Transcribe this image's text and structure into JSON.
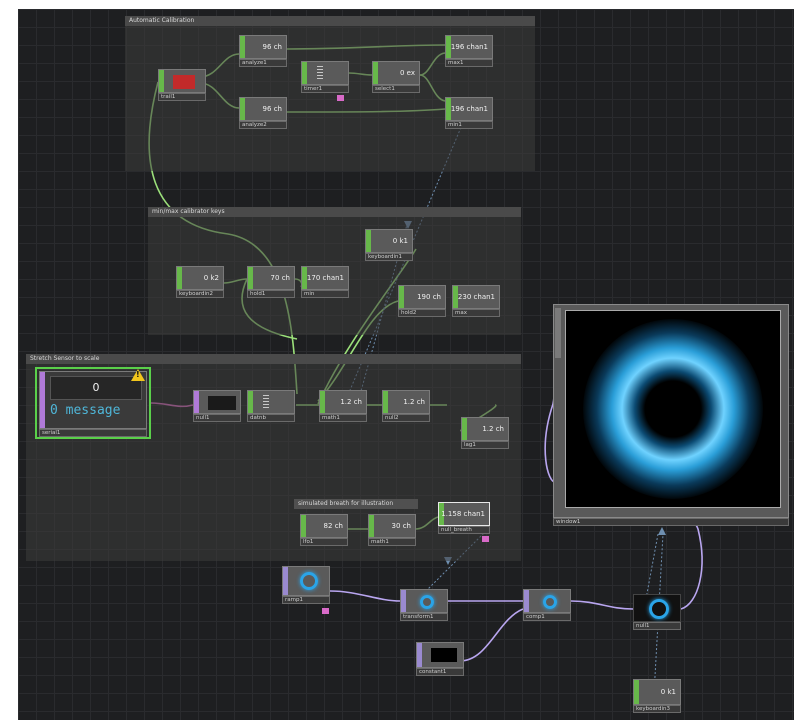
{
  "boxes": {
    "auto_calibration": "Automatic Calibration",
    "min_max_keys": "min/max calibrator keys",
    "stretch_sensor": "Stretch Sensor to scale",
    "simulated_breath": "simulated breath for illustration"
  },
  "nodes": {
    "serial1": {
      "label": "serial1",
      "value": "0",
      "message": "0 message",
      "warning": "!"
    },
    "analyze1": {
      "label": "analyze1",
      "value": "96",
      "unit": "ch"
    },
    "analyze2": {
      "label": "analyze2",
      "value": "96",
      "unit": "ch"
    },
    "timer1": {
      "label": "timer1"
    },
    "select1": {
      "label": "select1",
      "value": "0",
      "unit": "ex"
    },
    "max1": {
      "label": "max1",
      "value": "196",
      "unit": "chan1"
    },
    "min1": {
      "label": "min1",
      "value": "196",
      "unit": "chan1"
    },
    "trail1": {
      "label": "trail1"
    },
    "keyboardin1": {
      "label": "keyboardin1",
      "value": "0",
      "unit": "k1"
    },
    "keyboardin2": {
      "label": "keyboardin2",
      "value": "0",
      "unit": "k2"
    },
    "hold1": {
      "label": "hold1",
      "value": "70",
      "unit": "ch"
    },
    "min2": {
      "label": "min",
      "value": "170",
      "unit": "chan1"
    },
    "hold2": {
      "label": "hold2",
      "value": "190",
      "unit": "ch"
    },
    "max2": {
      "label": "max",
      "value": "230",
      "unit": "chan1"
    },
    "null1": {
      "label": "null1"
    },
    "datnb": {
      "label": "datnb"
    },
    "math1": {
      "label": "math1",
      "value": "1.2",
      "unit": "ch"
    },
    "null2": {
      "label": "null2",
      "value": "1.2",
      "unit": "ch"
    },
    "lag1": {
      "label": "lag1",
      "value": "1.2",
      "unit": "ch"
    },
    "lfo1": {
      "label": "lfo1",
      "value": "82",
      "unit": "ch"
    },
    "math2": {
      "label": "math1",
      "value": "30",
      "unit": "ch"
    },
    "null3": {
      "label": "null_breath",
      "value": "1.158",
      "unit": "chan1"
    },
    "ramp1": {
      "label": "ramp1"
    },
    "transform1": {
      "label": "transform1"
    },
    "comp1": {
      "label": "comp1"
    },
    "null4": {
      "label": "null1"
    },
    "constant1": {
      "label": "constant1"
    },
    "keyboardin3": {
      "label": "keyboardin3",
      "value": "0",
      "unit": "k1"
    },
    "window1": {
      "label": "window1"
    }
  },
  "colors": {
    "chop_wire": "#9be07a",
    "top_wire": "#b9a6f0",
    "dat_wire": "#e26fc6",
    "chop_tab": "#67b84a",
    "top_tab": "#9a8ad0",
    "ring": "#2aa4e8"
  }
}
